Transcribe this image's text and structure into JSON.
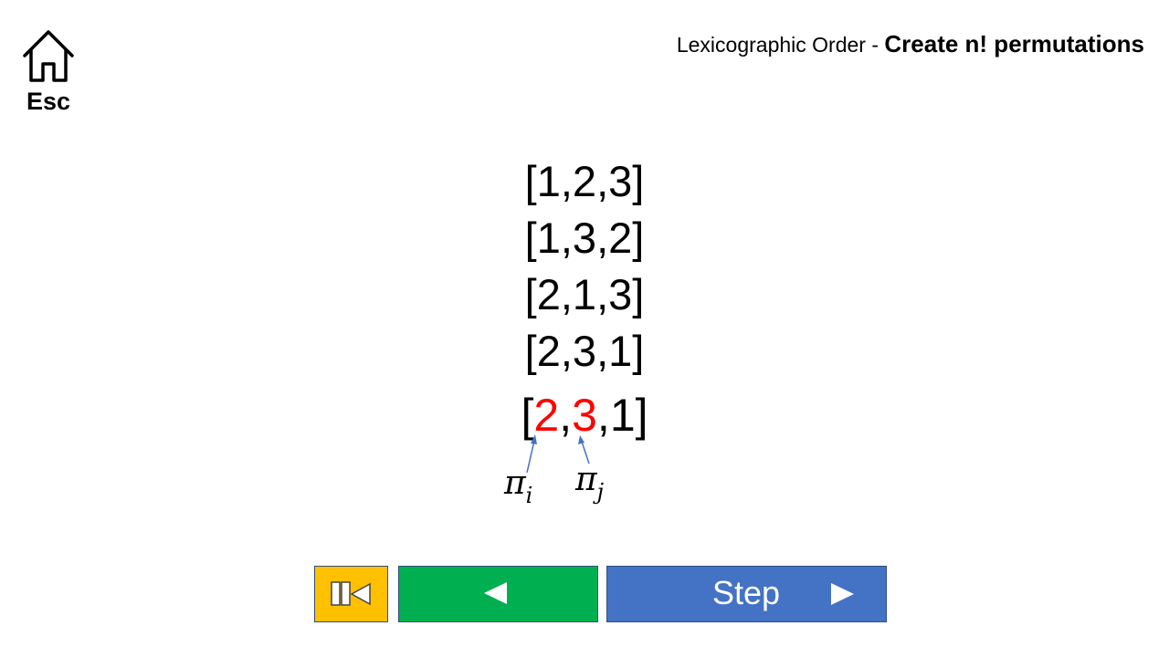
{
  "home": {
    "esc_label": "Esc",
    "icon": "home-icon"
  },
  "title": {
    "prefix": "Lexicographic Order - ",
    "bold": "Create n! permutations"
  },
  "permutations": [
    "[1,2,3]",
    "[1,3,2]",
    "[2,1,3]",
    "[2,3,1]"
  ],
  "current": {
    "open": "[",
    "pi_i_value": "2",
    "sep1": ",",
    "pi_j_value": "3",
    "rest": ",1]"
  },
  "labels": {
    "pi_symbol": "π",
    "i": "i",
    "j": "j"
  },
  "controls": {
    "reset_icon": "reset-to-start-icon",
    "back_icon": "step-back-icon",
    "step_label": "Step",
    "forward_icon": "step-forward-icon"
  },
  "colors": {
    "highlight": "#ff0000",
    "reset_button": "#ffc000",
    "back_button": "#00b050",
    "step_button": "#4472c4",
    "arrow": "#4472c4"
  }
}
